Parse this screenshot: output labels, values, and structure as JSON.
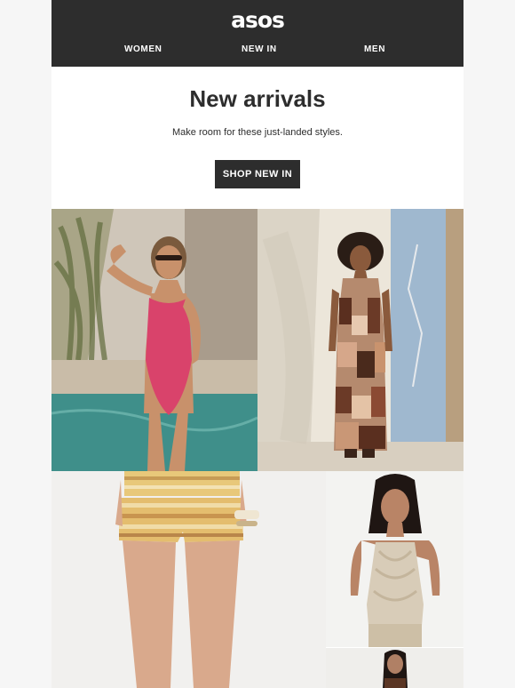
{
  "header": {
    "logo": "asos",
    "nav": [
      {
        "label": "WOMEN"
      },
      {
        "label": "NEW IN"
      },
      {
        "label": "MEN"
      }
    ]
  },
  "hero": {
    "title": "New arrivals",
    "subtitle": "Make room for these just-landed styles.",
    "cta_label": "SHOP NEW IN"
  },
  "colors": {
    "header_bg": "#2d2d2d",
    "button_bg": "#2d2d2d",
    "text": "#2d2d2d",
    "page_bg": "#f6f6f6"
  },
  "images": [
    {
      "name": "pink-swimsuit-photo"
    },
    {
      "name": "patchwork-maxi-dress-photo"
    },
    {
      "name": "striped-shorts-photo"
    },
    {
      "name": "crochet-halter-top-photo"
    },
    {
      "name": "brown-outfit-photo"
    }
  ]
}
